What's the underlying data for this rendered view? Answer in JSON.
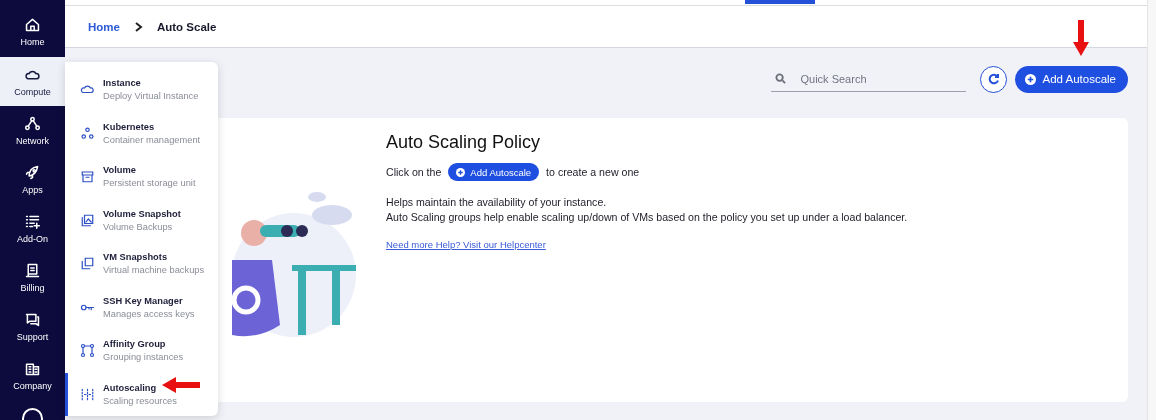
{
  "sidebar": {
    "items": [
      {
        "label": "Home",
        "selected": false
      },
      {
        "label": "Compute",
        "selected": true
      },
      {
        "label": "Network",
        "selected": false
      },
      {
        "label": "Apps",
        "selected": false
      },
      {
        "label": "Add-On",
        "selected": false
      },
      {
        "label": "Billing",
        "selected": false
      },
      {
        "label": "Support",
        "selected": false
      },
      {
        "label": "Company",
        "selected": false
      }
    ]
  },
  "breadcrumb": [
    {
      "label": "Home",
      "kind": "link"
    },
    {
      "label": "Auto Scale",
      "kind": "current"
    }
  ],
  "toolbar": {
    "search": {
      "placeholder": "Quick Search"
    },
    "add_button": "Add Autoscale"
  },
  "compute_menu": {
    "items": [
      {
        "title": "Instance",
        "subtitle": "Deploy Virtual Instance",
        "selected": false
      },
      {
        "title": "Kubernetes",
        "subtitle": "Container management",
        "selected": false
      },
      {
        "title": "Volume",
        "subtitle": "Persistent storage unit",
        "selected": false
      },
      {
        "title": "Volume Snapshot",
        "subtitle": "Volume Backups",
        "selected": false
      },
      {
        "title": "VM Snapshots",
        "subtitle": "Virtual machine backups",
        "selected": false
      },
      {
        "title": "SSH Key Manager",
        "subtitle": "Manages access keys",
        "selected": false
      },
      {
        "title": "Affinity Group",
        "subtitle": "Grouping instances",
        "selected": false
      },
      {
        "title": "Autoscaling",
        "subtitle": "Scaling resources",
        "selected": true
      }
    ]
  },
  "policy": {
    "title": "Auto Scaling Policy",
    "click_before": "Click on the",
    "inline_button": "Add Autoscale",
    "click_after": "to create a new one",
    "description": [
      "Helps maintain the availability of your instance.",
      "Auto Scaling groups help enable scaling up/down of VMs based on the policy you set up under a load balancer."
    ],
    "help_link": "Need more Help? Visit our Helpcenter"
  }
}
